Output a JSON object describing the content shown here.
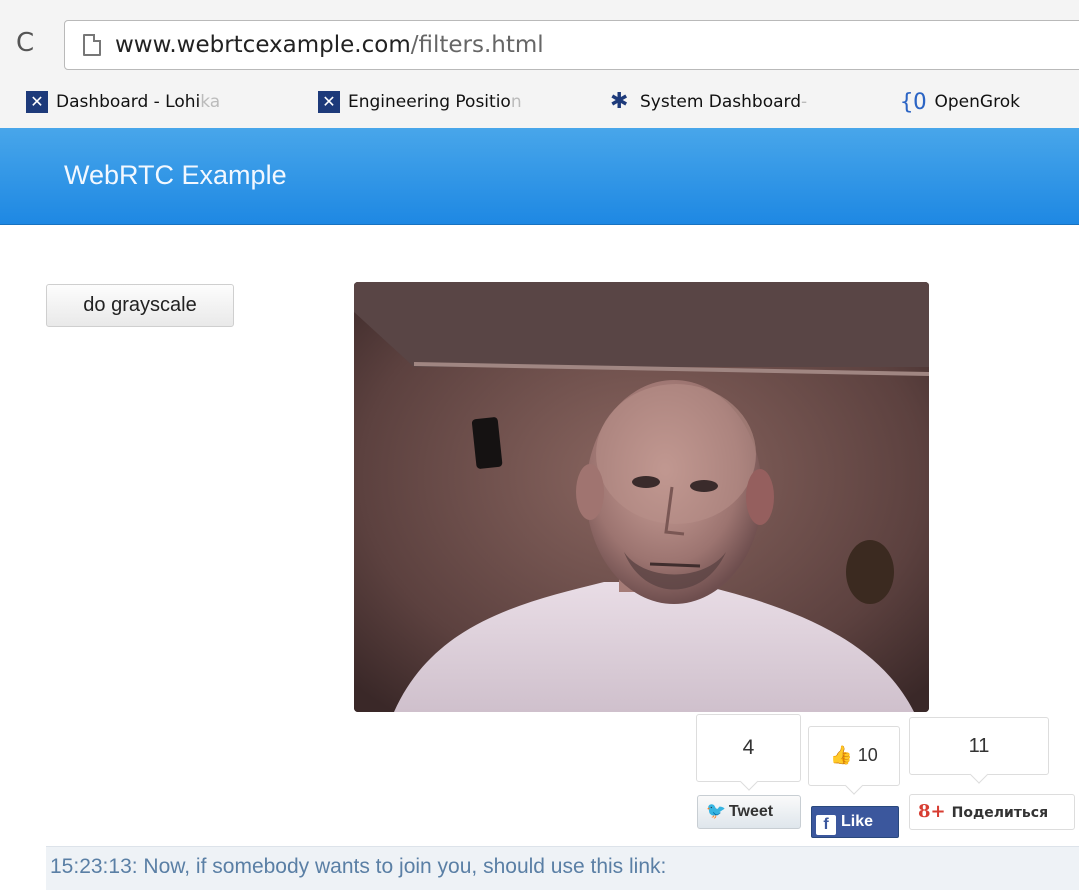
{
  "browser": {
    "url_host": "www.webrtcexample.com",
    "url_path": "/filters.html",
    "bookmarks": [
      {
        "label": "Dashboard - Lohi",
        "fade": "ka",
        "icon": "atlassian-x-icon"
      },
      {
        "label": "Engineering Positio",
        "fade": "n",
        "icon": "atlassian-x-icon"
      },
      {
        "label": "System Dashboard",
        "fade": " -",
        "icon": "jira-star-icon"
      },
      {
        "label": "OpenGrok",
        "fade": "",
        "icon": "opengrok-brace-icon"
      }
    ]
  },
  "header": {
    "title": "WebRTC Example"
  },
  "controls": {
    "grayscale_button": "do grayscale"
  },
  "social": {
    "tweet_count": "4",
    "tweet_label": "Tweet",
    "like_count": "10",
    "like_label": "Like",
    "plus_count": "11",
    "plus_label": "Поделиться"
  },
  "log": {
    "message": "15:23:13: Now, if somebody wants to join you, should use this link:"
  }
}
